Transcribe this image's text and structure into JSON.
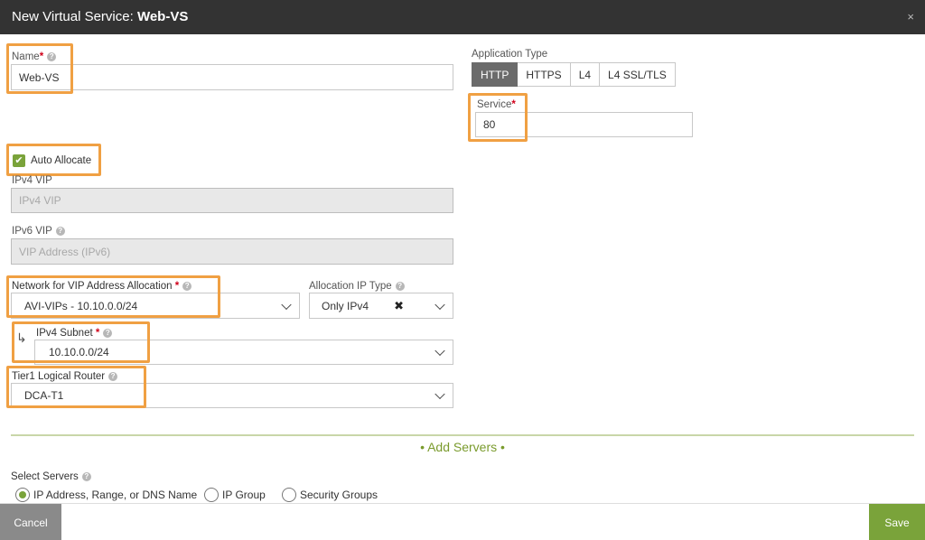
{
  "header": {
    "title_prefix": "New Virtual Service: ",
    "title_name": "Web-VS",
    "close_icon": "×"
  },
  "name": {
    "label": "Name",
    "required": "*",
    "value": "Web-VS"
  },
  "app_type": {
    "label": "Application Type",
    "options": [
      "HTTP",
      "HTTPS",
      "L4",
      "L4 SSL/TLS"
    ],
    "selected": "HTTP"
  },
  "service": {
    "label": "Service",
    "required": "*",
    "value": "80"
  },
  "auto_allocate": {
    "label": "Auto Allocate",
    "checked": true
  },
  "ipv4_vip": {
    "label": "IPv4 VIP",
    "placeholder": "IPv4 VIP"
  },
  "ipv6_vip": {
    "label": "IPv6 VIP",
    "placeholder": "VIP Address (IPv6)"
  },
  "network": {
    "label": "Network for VIP Address Allocation",
    "required": "*",
    "value": "AVI-VIPs - 10.10.0.0/24"
  },
  "alloc_ip_type": {
    "label": "Allocation IP Type",
    "value": "Only IPv4",
    "clear_icon": "✖"
  },
  "ipv4_subnet": {
    "label": "IPv4 Subnet",
    "required": "*",
    "value": "10.10.0.0/24"
  },
  "tier1": {
    "label": "Tier1 Logical Router",
    "value": "DCA-T1"
  },
  "add_servers": {
    "label": "• Add Servers •"
  },
  "select_servers": {
    "label": "Select Servers",
    "options": [
      "IP Address, Range, or DNS Name",
      "IP Group",
      "Security Groups"
    ],
    "selected": "IP Address, Range, or DNS Name"
  },
  "footer": {
    "cancel": "Cancel",
    "save": "Save"
  },
  "colors": {
    "accent_green": "#7aa33a",
    "highlight_orange": "#f0a043",
    "header_bg": "#333333"
  }
}
